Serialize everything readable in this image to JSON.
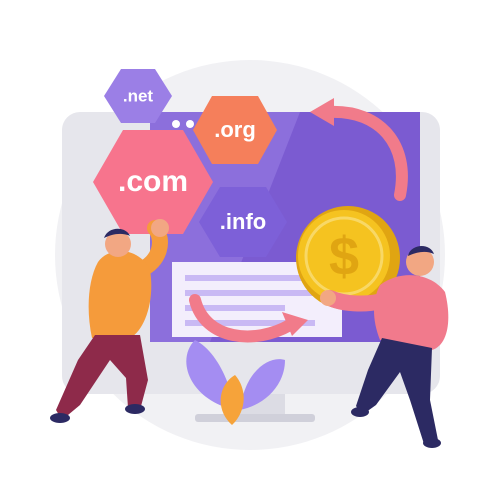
{
  "domains": {
    "net": ".net",
    "org": ".org",
    "com": ".com",
    "info": ".info"
  },
  "coin": {
    "symbol": "$"
  },
  "colors": {
    "background_circle": "#f1f1f4",
    "monitor_frame": "#e6e6ec",
    "monitor_screen": "#7b5bd1",
    "screen_highlight": "#b59df0",
    "hex_net": "#9b7fe6",
    "hex_org": "#f57f5b",
    "hex_com": "#f7748d",
    "hex_info": "#7d60d8",
    "arrow": "#f17b8a",
    "coin": "#f5c320",
    "coin_dark": "#e0a512",
    "plant": "#a48df2",
    "plant_accent": "#f6a33a",
    "person_left_shirt": "#f59b3b",
    "person_left_pants": "#8e2a4a",
    "person_right_shirt": "#f17a8c",
    "person_right_pants": "#2c2a63",
    "skin": "#f2a783"
  }
}
